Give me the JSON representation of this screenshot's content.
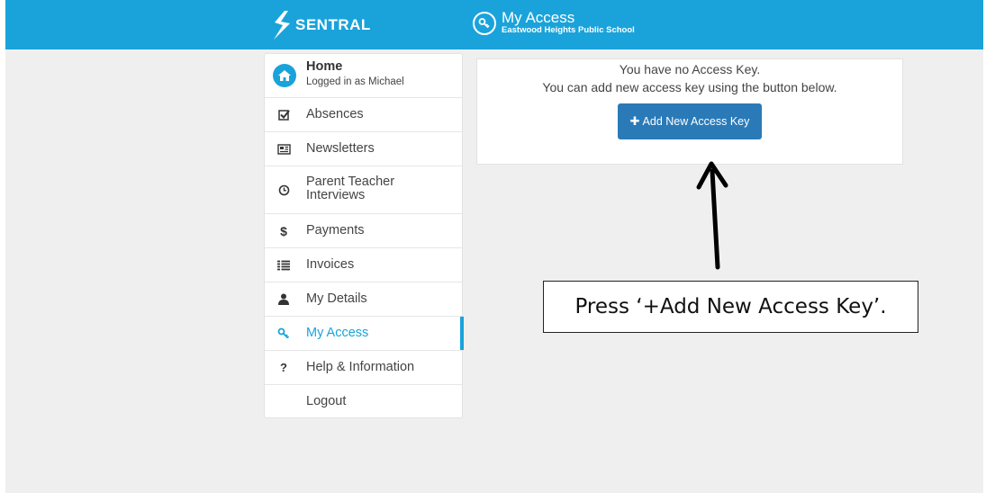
{
  "header": {
    "brand": "SENTRAL",
    "title": "My Access",
    "school": "Eastwood Heights Public School",
    "icon": "key-icon"
  },
  "sidebar": {
    "home": {
      "label": "Home",
      "sub": "Logged in as Michael",
      "icon": "home-icon"
    },
    "items": [
      {
        "label": "Absences",
        "icon": "check-square-icon"
      },
      {
        "label": "Newsletters",
        "icon": "newspaper-icon"
      },
      {
        "label": "Parent Teacher Interviews",
        "line1": "Parent Teacher",
        "line2": "Interviews",
        "icon": "clock-icon"
      },
      {
        "label": "Payments",
        "icon": "dollar-icon"
      },
      {
        "label": "Invoices",
        "icon": "list-icon"
      },
      {
        "label": "My Details",
        "icon": "user-icon"
      },
      {
        "label": "My Access",
        "icon": "key-icon",
        "active": true
      },
      {
        "label": "Help & Information",
        "icon": "question-icon"
      },
      {
        "label": "Logout"
      }
    ]
  },
  "main": {
    "message_line1": "You have no Access Key.",
    "message_line2": "You can add new access key using the button below.",
    "add_button": {
      "plus": "✚",
      "label": "Add New Access Key"
    }
  },
  "annotation": {
    "callout_text": "Press ‘+Add New Access Key’."
  },
  "colors": {
    "accent": "#1aa3da",
    "button": "#2a7ab8",
    "background": "#efefef"
  }
}
